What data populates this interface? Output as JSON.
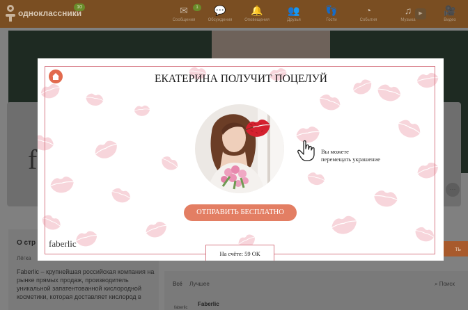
{
  "header": {
    "site_name": "одноклассники",
    "notifications_count": "10",
    "messages_count": "1",
    "nav": [
      {
        "label": "Сообщения",
        "icon": "envelope-icon"
      },
      {
        "label": "Обсуждения",
        "icon": "speech-bubbles-icon"
      },
      {
        "label": "Оповещения",
        "icon": "bell-icon"
      },
      {
        "label": "Друзья",
        "icon": "people-icon"
      },
      {
        "label": "Гости",
        "icon": "footprints-icon"
      },
      {
        "label": "События",
        "icon": "events-icon"
      },
      {
        "label": "Музыка",
        "icon": "music-note-icon"
      },
      {
        "label": "Видео",
        "icon": "film-camera-icon"
      }
    ]
  },
  "background_page": {
    "profile_initial": "f",
    "about_title": "О стр",
    "about_subtitle": "Лёгка",
    "about_text": "Faberlic – крупнейшая российская компания на рынке прямых продаж, производитель уникальной запатентованной кислородной косметики, которая доставляет кислород в",
    "feed_filter_all": "Всё",
    "feed_filter_best": "Лучшее",
    "search_label": "Поиск",
    "post_author": "Faberlic",
    "join_button_fragment": "ть"
  },
  "modal": {
    "title": "ЕКАТЕРИНА ПОЛУЧИТ ПОЦЕЛУЙ",
    "hint_line1": "Вы можете",
    "hint_line2": "перемещать украшение",
    "send_button_label": "ОТПРАВИТЬ БЕСПЛАТНО",
    "balance_text": "На счёте: 59 ОК",
    "brand_logo_text": "faberlic",
    "home_icon": "home-icon",
    "cursor_icon": "hand-pointer-icon",
    "decoration_icon": "lips-kiss-icon"
  },
  "colors": {
    "accent": "#e37e63",
    "frame": "#d77a86",
    "kiss_pattern": "#f5c7cf",
    "kiss_sticker": "#d4202e",
    "header_dimmed": "#7a4e22"
  }
}
